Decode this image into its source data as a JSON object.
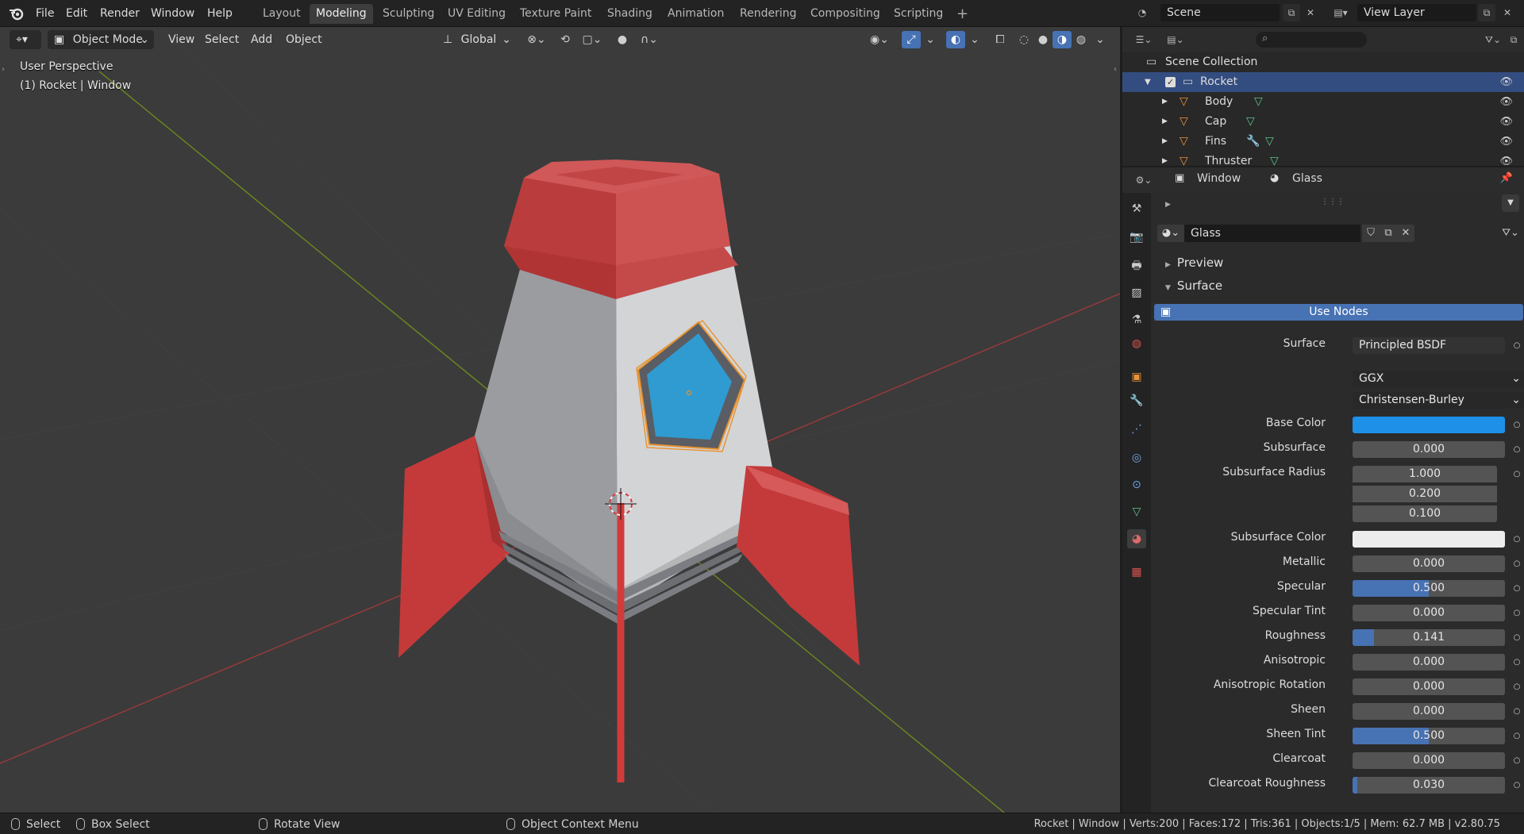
{
  "menu": [
    "File",
    "Edit",
    "Render",
    "Window",
    "Help"
  ],
  "workspaces": [
    {
      "label": "Layout",
      "active": false
    },
    {
      "label": "Modeling",
      "active": true
    },
    {
      "label": "Sculpting",
      "active": false
    },
    {
      "label": "UV Editing",
      "active": false
    },
    {
      "label": "Texture Paint",
      "active": false
    },
    {
      "label": "Shading",
      "active": false
    },
    {
      "label": "Animation",
      "active": false
    },
    {
      "label": "Rendering",
      "active": false
    },
    {
      "label": "Compositing",
      "active": false
    },
    {
      "label": "Scripting",
      "active": false
    }
  ],
  "scene": {
    "name": "Scene",
    "view_layer": "View Layer"
  },
  "viewport": {
    "mode": "Object Mode",
    "menus": [
      "View",
      "Select",
      "Add",
      "Object"
    ],
    "orientation": "Global",
    "overlay_title": "User Perspective",
    "overlay_subtitle": "(1) Rocket | Window"
  },
  "outliner": {
    "root": "Scene Collection",
    "collection": "Rocket",
    "items": [
      "Body",
      "Cap",
      "Fins",
      "Thruster"
    ]
  },
  "properties": {
    "breadcrumb_object": "Window",
    "breadcrumb_material": "Glass",
    "material_name": "Glass",
    "panel_preview": "Preview",
    "panel_surface": "Surface",
    "use_nodes": "Use Nodes",
    "surface_label": "Surface",
    "surface_value": "Principled BSDF",
    "distribution": "GGX",
    "subsurface_method": "Christensen-Burley",
    "base_color_label": "Base Color",
    "base_color": "#1e90e8",
    "subsurface_color_label": "Subsurface Color",
    "subsurface_color": "#ededed",
    "subsurface_radius_label": "Subsurface Radius",
    "subsurface_radius": [
      "1.000",
      "0.200",
      "0.100"
    ],
    "fields": [
      {
        "label": "Subsurface",
        "value": "0.000",
        "fill": 0
      },
      {
        "label": "Metallic",
        "value": "0.000",
        "fill": 0
      },
      {
        "label": "Specular",
        "value": "0.500",
        "fill": 0.5
      },
      {
        "label": "Specular Tint",
        "value": "0.000",
        "fill": 0
      },
      {
        "label": "Roughness",
        "value": "0.141",
        "fill": 0.141
      },
      {
        "label": "Anisotropic",
        "value": "0.000",
        "fill": 0
      },
      {
        "label": "Anisotropic Rotation",
        "value": "0.000",
        "fill": 0
      },
      {
        "label": "Sheen",
        "value": "0.000",
        "fill": 0
      },
      {
        "label": "Sheen Tint",
        "value": "0.500",
        "fill": 0.5
      },
      {
        "label": "Clearcoat",
        "value": "0.000",
        "fill": 0
      },
      {
        "label": "Clearcoat Roughness",
        "value": "0.030",
        "fill": 0.03
      }
    ]
  },
  "status": {
    "select": "Select",
    "box_select": "Box Select",
    "rotate_view": "Rotate View",
    "context_menu": "Object Context Menu",
    "stats": "Rocket | Window | Verts:200 | Faces:172 | Tris:361 | Objects:1/5 | Mem: 62.7 MB | v2.80.75"
  },
  "colors": {
    "accent": "#4772b3",
    "selection": "#334d80",
    "rocket_red": "#c94848",
    "window_blue": "#2f9bd0"
  }
}
